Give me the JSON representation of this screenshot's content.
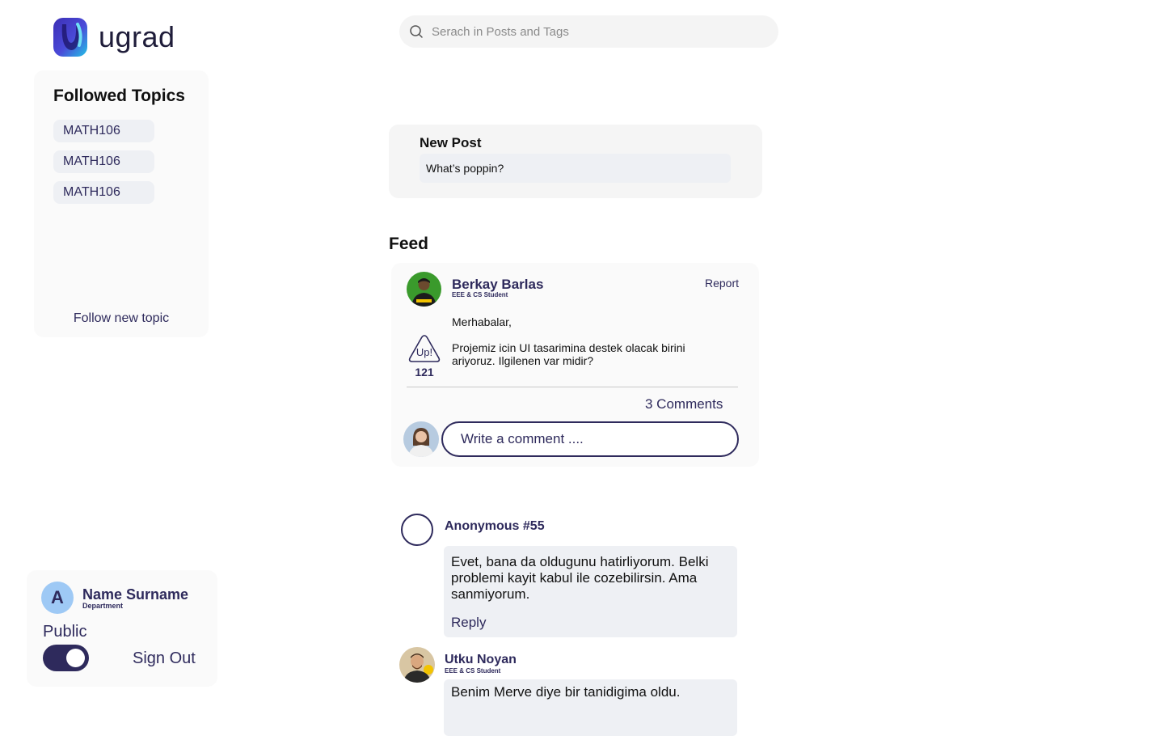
{
  "app": {
    "name": "ugrad"
  },
  "search": {
    "placeholder": "Serach in Posts and Tags"
  },
  "sidebar": {
    "title": "Followed Topics",
    "topics": [
      "MATH106",
      "MATH106",
      "MATH106"
    ],
    "follow_label": "Follow new topic"
  },
  "profile": {
    "initial": "A",
    "name": "Name Surname",
    "department": "Department",
    "visibility_label": "Public",
    "visibility_on": true,
    "signout_label": "Sign Out"
  },
  "new_post": {
    "title": "New Post",
    "placeholder": "What’s poppin?"
  },
  "feed": {
    "title": "Feed",
    "post": {
      "author": "Berkay Barlas",
      "role": "EEE & CS Student",
      "report_label": "Report",
      "greeting": "Merhabalar,",
      "body": "Projemiz icin UI tasarimina destek olacak birini ariyoruz. Ilgilenen var midir?",
      "upvote_label": "Up!",
      "upvotes": "121",
      "comments_label": "3 Comments",
      "comment_placeholder": "Write a comment ...."
    }
  },
  "comments": [
    {
      "author": "Anonymous #55",
      "text": "Evet, bana da oldugunu hatirliyorum. Belki problemi kayit kabul ile cozebilirsin. Ama sanmiyorum.",
      "reply_label": "Reply"
    },
    {
      "author": "Utku Noyan",
      "role": "EEE & CS Student",
      "text": "Benim Merve diye bir tanidigima oldu."
    }
  ],
  "colors": {
    "primary": "#2e2a5c",
    "chip": "#eef0f4",
    "card": "#fafafa"
  }
}
